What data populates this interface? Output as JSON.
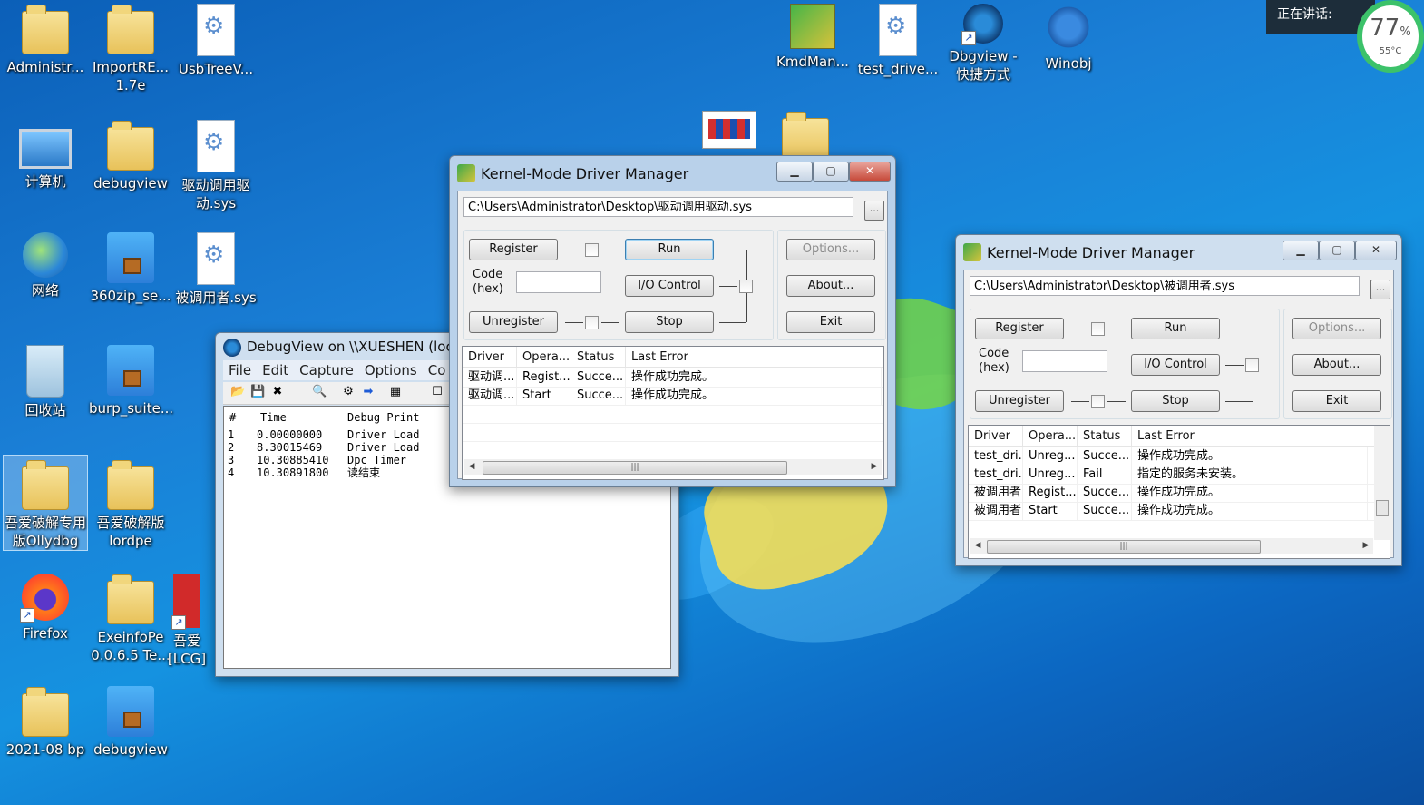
{
  "desktop_icons": [
    {
      "label": "Administr...",
      "icon": "user-folder-icon"
    },
    {
      "label": "ImportRE... 1.7e",
      "icon": "folder-icon"
    },
    {
      "label": "UsbTreeV...",
      "icon": "sys-file-icon"
    },
    {
      "label": "计算机",
      "icon": "computer-icon"
    },
    {
      "label": "debugview",
      "icon": "folder-icon"
    },
    {
      "label": "驱动调用驱动.sys",
      "icon": "sys-file-icon"
    },
    {
      "label": "网络",
      "icon": "network-icon"
    },
    {
      "label": "360zip_se...",
      "icon": "zip-installer-icon"
    },
    {
      "label": "被调用者.sys",
      "icon": "sys-file-icon"
    },
    {
      "label": "回收站",
      "icon": "recycle-bin-icon"
    },
    {
      "label": "burp_suite...",
      "icon": "zip-archive-icon"
    },
    {
      "label": "吾爱破解专用版Ollydbg",
      "icon": "folder-icon"
    },
    {
      "label": "吾爱破解版lordpe",
      "icon": "folder-icon"
    },
    {
      "label": "Firefox",
      "icon": "firefox-icon"
    },
    {
      "label": "ExeinfoPe 0.0.6.5 Te...",
      "icon": "folder-icon"
    },
    {
      "label": "吾爱 [LCG]",
      "icon": "red-app-icon"
    },
    {
      "label": "2021-08 bp",
      "icon": "folder-icon"
    },
    {
      "label": "debugview",
      "icon": "zip-archive-icon"
    },
    {
      "label": "KmdMan...",
      "icon": "kmd-manager-icon"
    },
    {
      "label": "test_drive...",
      "icon": "sys-file-icon"
    },
    {
      "label": "Dbgview - 快捷方式",
      "icon": "bug-icon"
    },
    {
      "label": "Winobj",
      "icon": "gears-icon"
    }
  ],
  "tray": {
    "speaking": "正在讲话:",
    "cpu_percent": "77",
    "percent_sign": "%",
    "temperature": "55°C"
  },
  "kmd1": {
    "title": "Kernel-Mode Driver Manager",
    "path": "C:\\Users\\Administrator\\Desktop\\驱动调用驱动.sys",
    "browse": "...",
    "register": "Register",
    "run": "Run",
    "code_label": "Code",
    "hex_label": "(hex)",
    "io_control": "I/O Control",
    "unregister": "Unregister",
    "stop": "Stop",
    "options": "Options...",
    "about": "About...",
    "exit": "Exit",
    "columns": [
      "Driver",
      "Opera...",
      "Status",
      "Last Error"
    ],
    "rows": [
      [
        "驱动调...",
        "Regist...",
        "Succe...",
        "操作成功完成。"
      ],
      [
        "驱动调...",
        "Start",
        "Succe...",
        "操作成功完成。"
      ]
    ]
  },
  "kmd2": {
    "title": "Kernel-Mode Driver Manager",
    "path": "C:\\Users\\Administrator\\Desktop\\被调用者.sys",
    "browse": "...",
    "register": "Register",
    "run": "Run",
    "code_label": "Code",
    "hex_label": "(hex)",
    "io_control": "I/O Control",
    "unregister": "Unregister",
    "stop": "Stop",
    "options": "Options...",
    "about": "About...",
    "exit": "Exit",
    "columns": [
      "Driver",
      "Opera...",
      "Status",
      "Last Error"
    ],
    "rows": [
      [
        "test_dri...",
        "Unreg...",
        "Succe...",
        "操作成功完成。"
      ],
      [
        "test_dri...",
        "Unreg...",
        "Fail",
        "指定的服务未安装。"
      ],
      [
        "被调用者",
        "Regist...",
        "Succe...",
        "操作成功完成。"
      ],
      [
        "被调用者",
        "Start",
        "Succe...",
        "操作成功完成。"
      ]
    ]
  },
  "debugview": {
    "title": "DebugView on \\\\XUESHEN (loc",
    "menu": [
      "File",
      "Edit",
      "Capture",
      "Options",
      "Co"
    ],
    "columns": [
      "#",
      "Time",
      "Debug Print"
    ],
    "rows": [
      [
        "1",
        "0.00000000",
        "Driver Load"
      ],
      [
        "2",
        "8.30015469",
        "Driver Load"
      ],
      [
        "3",
        "10.30885410",
        "Dpc Timer"
      ],
      [
        "4",
        "10.30891800",
        "读结束"
      ]
    ]
  }
}
